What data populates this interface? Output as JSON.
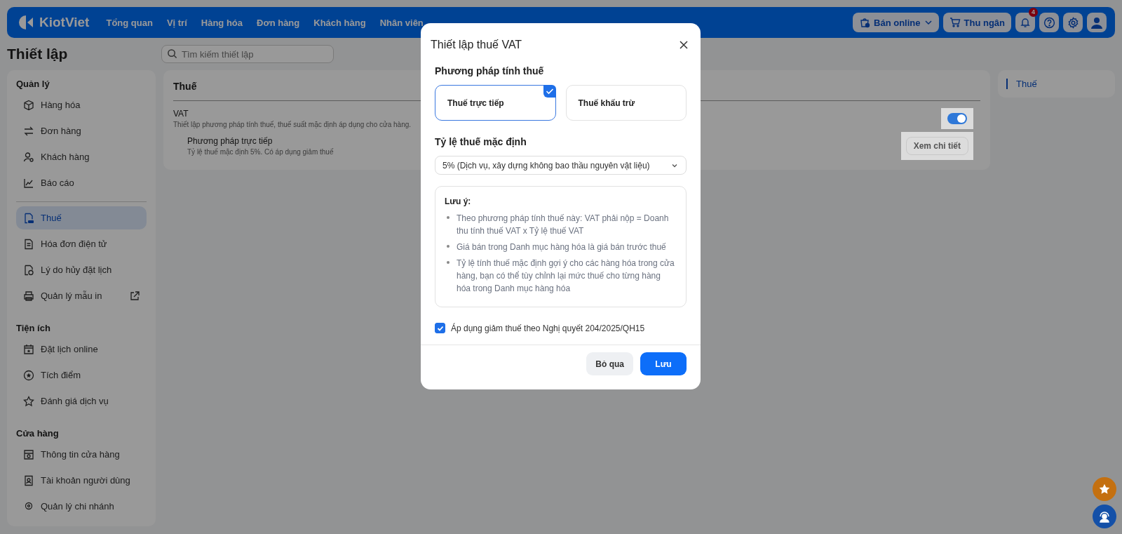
{
  "nav": {
    "logo": "KiotViet",
    "items": [
      "Tổng quan",
      "Vị trí",
      "Hàng hóa",
      "Đơn hàng",
      "Khách hàng",
      "Nhân viên"
    ],
    "online_button": "Bán online",
    "cashier_button": "Thu ngân",
    "notification_count": "4"
  },
  "page": {
    "title": "Thiết lập",
    "search": {
      "placeholder": "Tìm kiếm thiết lập"
    }
  },
  "sidebar": {
    "sections": [
      {
        "title": "Quản lý",
        "items": [
          {
            "label": "Hàng hóa",
            "selected": false,
            "external": false
          },
          {
            "label": "Đơn hàng",
            "selected": false,
            "external": false
          },
          {
            "label": "Khách hàng",
            "selected": false,
            "external": false
          },
          {
            "label": "Báo cáo",
            "selected": false,
            "external": false
          }
        ]
      },
      {
        "items": [
          {
            "label": "Thuế",
            "selected": true,
            "external": false
          },
          {
            "label": "Hóa đơn điện tử",
            "selected": false,
            "external": false
          },
          {
            "label": "Lý do hủy đặt lịch",
            "selected": false,
            "external": false
          },
          {
            "label": "Quản lý mẫu in",
            "selected": false,
            "external": true
          }
        ]
      },
      {
        "title": "Tiện ích",
        "items": [
          {
            "label": "Đặt lịch online",
            "selected": false,
            "external": false
          },
          {
            "label": "Tích điểm",
            "selected": false,
            "external": false
          },
          {
            "label": "Đánh giá dịch vụ",
            "selected": false,
            "external": false
          }
        ]
      },
      {
        "title": "Cửa hàng",
        "items": [
          {
            "label": "Thông tin cửa hàng",
            "selected": false,
            "external": false
          },
          {
            "label": "Tài khoản người dùng",
            "selected": false,
            "external": false
          },
          {
            "label": "Quản lý chi nhánh",
            "selected": false,
            "external": false
          }
        ]
      }
    ]
  },
  "main": {
    "title": "Thuế",
    "setting": {
      "name": "VAT",
      "description": "Thiết lập phương pháp tính thuế, thuế suất mặc định áp dụng cho cửa hàng.",
      "on": true,
      "method": {
        "name": "Phương pháp trực tiếp",
        "detail": "Tỷ lệ thuế mặc định 5%. Có áp dụng giảm thuế",
        "button": "Xem chi tiết"
      }
    }
  },
  "toc": [
    {
      "label": "Thuế",
      "selected": true
    }
  ],
  "modal": {
    "title": "Thiết lập thuế VAT",
    "method_label": "Phương pháp tính thuế",
    "methods": [
      {
        "label": "Thuế trực tiếp",
        "selected": true
      },
      {
        "label": "Thuế khấu trừ",
        "selected": false
      }
    ],
    "rate_label": "Tỷ lệ thuế mặc định",
    "rate_value": "5% (Dịch vụ, xây dựng không bao thầu nguyên vật liệu)",
    "note": {
      "title": "Lưu ý:",
      "items": [
        "Theo phương pháp tính thuế này: VAT phải nộp = Doanh thu tính thuế VAT x Tỷ lệ thuế VAT",
        "Giá bán trong Danh mục hàng hóa là giá bán trước thuế",
        "Tỷ lệ tính thuế mặc định gợi ý cho các hàng hóa trong cửa hàng, bạn có thể tùy chỉnh lại mức thuế cho từng hàng hóa trong Danh mục hàng hóa"
      ]
    },
    "reduction": {
      "label": "Áp dụng giảm thuế theo Nghị quyết 204/2025/QH15",
      "checked": true
    },
    "buttons": [
      {
        "label": "Bỏ qua",
        "kind": "secondary"
      },
      {
        "label": "Lưu",
        "kind": "primary"
      }
    ]
  }
}
